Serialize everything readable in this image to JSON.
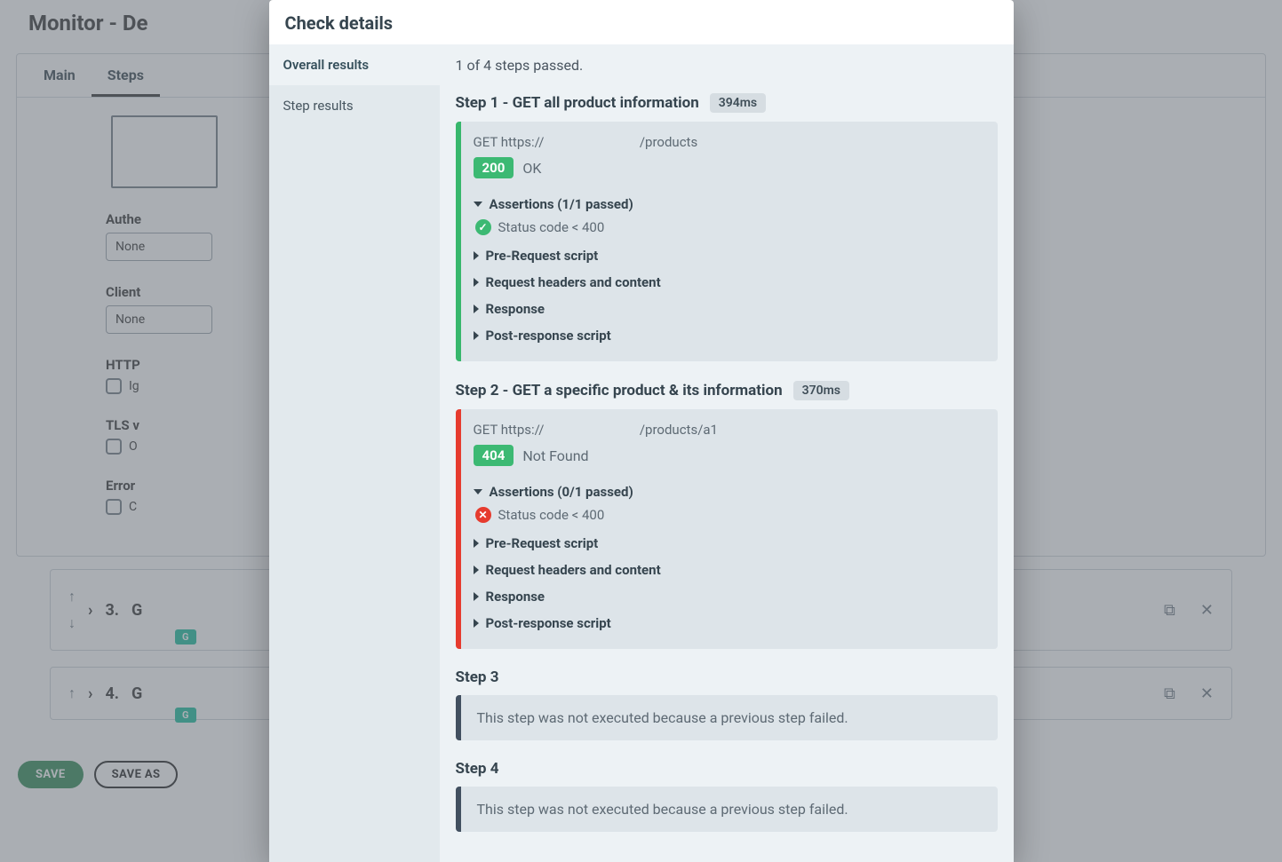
{
  "page": {
    "title": "Monitor - De"
  },
  "tabs": [
    "Main",
    "Steps"
  ],
  "form": {
    "auth_label": "Authe",
    "auth_value": "None",
    "client_label": "Client",
    "client_value": "None",
    "http_label": "HTTP",
    "http_chk": "Ig",
    "tls_label": "TLS v",
    "tls_chk": "O",
    "err_label": "Error",
    "err_chk": "C"
  },
  "rows": [
    {
      "num": "3.",
      "title": "G",
      "pill": "G"
    },
    {
      "num": "4.",
      "title": "G",
      "pill": "G"
    }
  ],
  "buttons": {
    "save": "SAVE",
    "save_as": "SAVE AS"
  },
  "modal": {
    "title": "Check details",
    "sidebar": [
      "Overall results",
      "Step results"
    ],
    "summary": "1 of 4 steps passed.",
    "collapsed_sections": [
      "Pre-Request script",
      "Request headers and content",
      "Response",
      "Post-response script"
    ],
    "steps": [
      {
        "id": 1,
        "title": "Step 1 - GET all product information",
        "time": "394ms",
        "stripe": "green",
        "request_prefix": "GET https://",
        "request_suffix": "/products",
        "code": "200",
        "status": "OK",
        "assert_header": "Assertions (1/1 passed)",
        "assert_text": "Status code < 400",
        "assert_pass": true
      },
      {
        "id": 2,
        "title": "Step 2 - GET a specific product & its information",
        "time": "370ms",
        "stripe": "red",
        "request_prefix": "GET https://",
        "request_suffix": "/products/a1",
        "code": "404",
        "status": "Not Found",
        "assert_header": "Assertions (0/1 passed)",
        "assert_text": "Status code < 400",
        "assert_pass": false
      },
      {
        "id": 3,
        "title": "Step 3",
        "skip": true,
        "skip_msg": "This step was not executed because a previous step failed."
      },
      {
        "id": 4,
        "title": "Step 4",
        "skip": true,
        "skip_msg": "This step was not executed because a previous step failed."
      }
    ]
  }
}
